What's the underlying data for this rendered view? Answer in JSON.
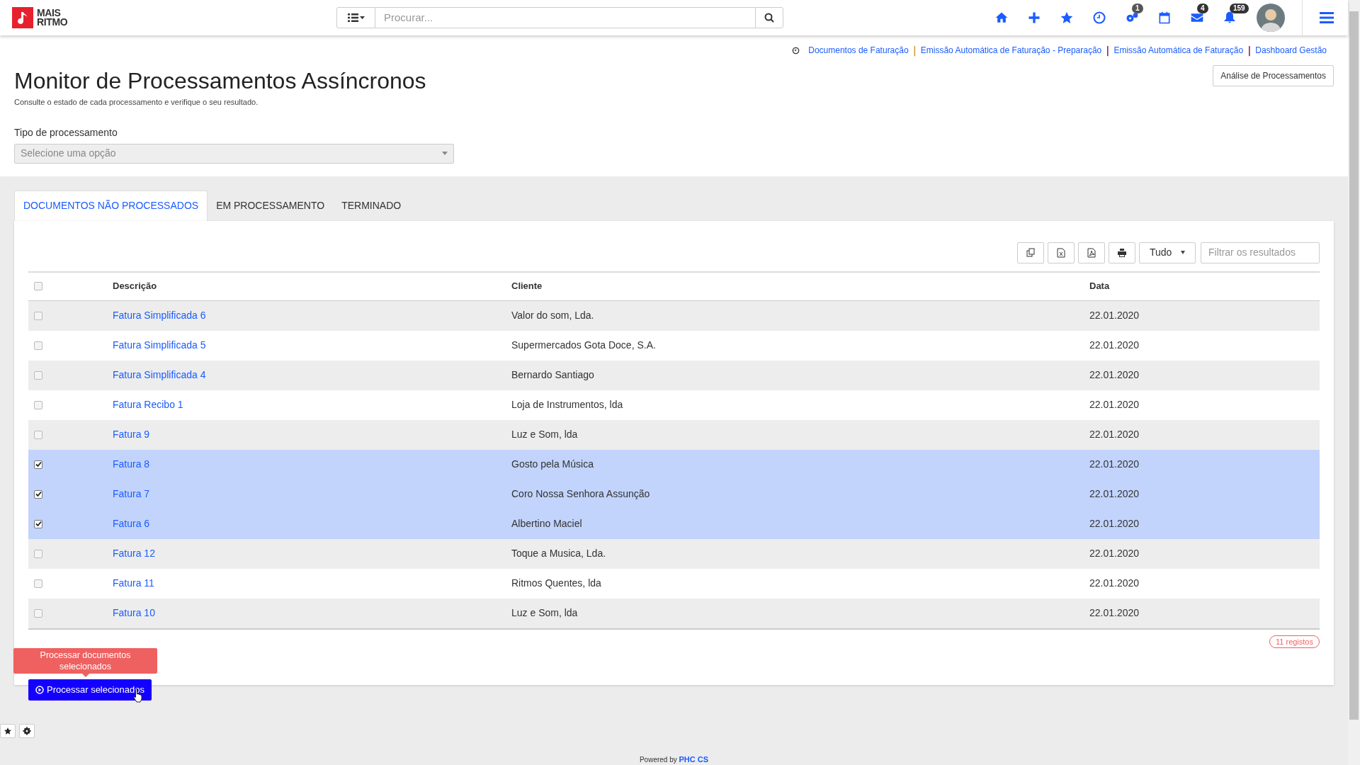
{
  "header": {
    "logo": [
      "MAIS",
      "RITMO"
    ],
    "search": {
      "placeholder": "Procurar..."
    },
    "icons": [
      {
        "kind": "home"
      },
      {
        "kind": "plus"
      },
      {
        "kind": "star"
      },
      {
        "kind": "clock"
      },
      {
        "kind": "gears",
        "badge": "1"
      },
      {
        "kind": "calendar"
      },
      {
        "kind": "mail",
        "badge": "4"
      },
      {
        "kind": "bell",
        "badge": "159"
      }
    ]
  },
  "breadcrumbs": [
    {
      "kind": "link",
      "text": "Documentos de Faturação"
    },
    {
      "kind": "separator",
      "text": "|",
      "color": "#c8a040"
    },
    {
      "kind": "link",
      "text": "Emissão Automática de Faturação - Preparação"
    },
    {
      "kind": "separator",
      "text": "|",
      "color": "#8a2060"
    },
    {
      "kind": "link",
      "text": "Emissão Automática de Faturação"
    },
    {
      "kind": "separator",
      "text": "|",
      "color": "#8a2060"
    },
    {
      "kind": "link",
      "text": "Dashboard Gestão"
    }
  ],
  "analysis_button": "Análise de Processamentos",
  "title": "Monitor de Processamentos Assíncronos",
  "subtitle": "Consulte o estado de cada processamento e verifique o seu resultado.",
  "type_field": {
    "label": "Tipo de processamento",
    "placeholder": "Selecione uma opção"
  },
  "tabs": [
    {
      "label": "DOCUMENTOS NÃO PROCESSADOS",
      "selected": true
    },
    {
      "label": "EM PROCESSAMENTO",
      "selected": false
    },
    {
      "label": "TERMINADO",
      "selected": false
    }
  ],
  "toolbar": {
    "page_size": "Tudo",
    "filter": {
      "placeholder": "Filtrar os resultados"
    }
  },
  "table": {
    "columns": [
      "Descrição",
      "Cliente",
      "Data"
    ],
    "all_checked": false,
    "rows": [
      {
        "description": "Fatura Simplificada 6",
        "client": "Valor do som, Lda.",
        "date": "22.01.2020",
        "checked": false
      },
      {
        "description": "Fatura Simplificada 5",
        "client": "Supermercados Gota Doce, S.A.",
        "date": "22.01.2020",
        "checked": false
      },
      {
        "description": "Fatura Simplificada 4",
        "client": "Bernardo Santiago",
        "date": "22.01.2020",
        "checked": false
      },
      {
        "description": "Fatura Recibo 1",
        "client": "Loja de Instrumentos, lda",
        "date": "22.01.2020",
        "checked": false
      },
      {
        "description": "Fatura 9",
        "client": "Luz e Som, lda",
        "date": "22.01.2020",
        "checked": false
      },
      {
        "description": "Fatura 8",
        "client": "Gosto pela Música",
        "date": "22.01.2020",
        "checked": true
      },
      {
        "description": "Fatura 7",
        "client": "Coro Nossa Senhora Assunção",
        "date": "22.01.2020",
        "checked": true
      },
      {
        "description": "Fatura 6",
        "client": "Albertino Maciel",
        "date": "22.01.2020",
        "checked": true
      },
      {
        "description": "Fatura 12",
        "client": "Toque a Musica, Lda.",
        "date": "22.01.2020",
        "checked": false
      },
      {
        "description": "Fatura 11",
        "client": "Ritmos Quentes, lda",
        "date": "22.01.2020",
        "checked": false
      },
      {
        "description": "Fatura 10",
        "client": "Luz e Som, lda",
        "date": "22.01.2020",
        "checked": false
      }
    ]
  },
  "record_count": "11 registos",
  "tooltip": "Processar documentos selecionados",
  "process_button": "Processar selecionados",
  "footer": {
    "prefix": "Powered by",
    "brand": "PHC CS"
  }
}
